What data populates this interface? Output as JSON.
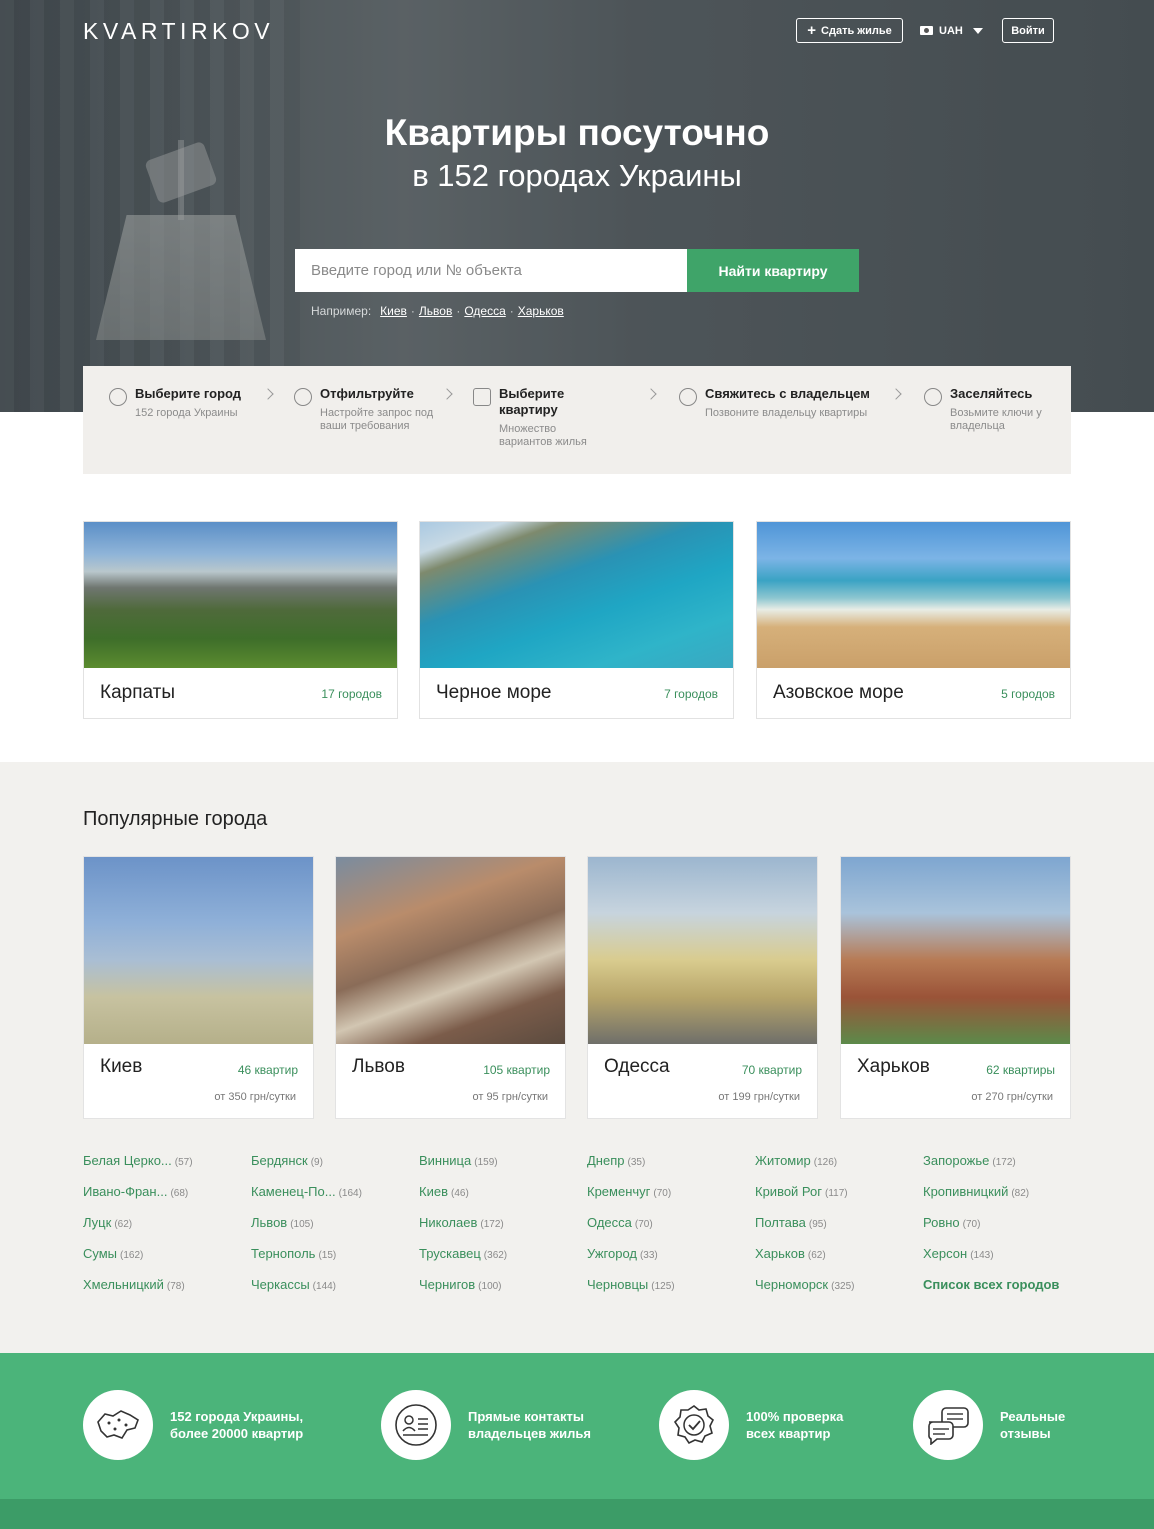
{
  "header": {
    "logo": "KVARTIRKOV",
    "rent_label": "Сдать жилье",
    "currency": "UAH",
    "login_label": "Войти"
  },
  "hero": {
    "title": "Квартиры посуточно",
    "subtitle": "в 152 городах Украины",
    "search_placeholder": "Введите город или № объекта",
    "search_button": "Найти квартиру",
    "examples_label": "Например:",
    "examples": [
      "Киев",
      "Львов",
      "Одесса",
      "Харьков"
    ]
  },
  "steps": [
    {
      "icon": "search-icon",
      "title": "Выберите город",
      "desc": "152 города Украины"
    },
    {
      "icon": "target-icon",
      "title": "Отфильтруйте",
      "desc": "Настройте запрос под ваши требования"
    },
    {
      "icon": "pin-icon",
      "title": "Выберите квартиру",
      "desc": "Множество вариантов жилья"
    },
    {
      "icon": "phone-icon",
      "title": "Свяжитесь с владельцем",
      "desc": "Позвоните владельцу квартиры"
    },
    {
      "icon": "key-icon",
      "title": "Заселяйтесь",
      "desc": "Возьмите ключи у владельца"
    }
  ],
  "regions": [
    {
      "name": "Карпаты",
      "count": "17 городов"
    },
    {
      "name": "Черное море",
      "count": "7 городов"
    },
    {
      "name": "Азовское море",
      "count": "5 городов"
    }
  ],
  "popular": {
    "title": "Популярные города",
    "cities": [
      {
        "name": "Киев",
        "count": "46 квартир",
        "price": "от 350 грн/сутки"
      },
      {
        "name": "Львов",
        "count": "105 квартир",
        "price": "от 95 грн/сутки"
      },
      {
        "name": "Одесса",
        "count": "70 квартир",
        "price": "от 199 грн/сутки"
      },
      {
        "name": "Харьков",
        "count": "62 квартиры",
        "price": "от 270 грн/сутки"
      }
    ]
  },
  "city_list": [
    [
      {
        "name": "Белая Церко...",
        "n": "(57)"
      },
      {
        "name": "Бердянск",
        "n": "(9)"
      },
      {
        "name": "Винница",
        "n": "(159)"
      },
      {
        "name": "Днепр",
        "n": "(35)"
      },
      {
        "name": "Житомир",
        "n": "(126)"
      },
      {
        "name": "Запорожье",
        "n": "(172)"
      }
    ],
    [
      {
        "name": "Ивано-Фран...",
        "n": "(68)"
      },
      {
        "name": "Каменец-По...",
        "n": "(164)"
      },
      {
        "name": "Киев",
        "n": "(46)"
      },
      {
        "name": "Кременчуг",
        "n": "(70)"
      },
      {
        "name": "Кривой Рог",
        "n": "(117)"
      },
      {
        "name": "Кропивницкий",
        "n": "(82)"
      }
    ],
    [
      {
        "name": "Луцк",
        "n": "(62)"
      },
      {
        "name": "Львов",
        "n": "(105)"
      },
      {
        "name": "Николаев",
        "n": "(172)"
      },
      {
        "name": "Одесса",
        "n": "(70)"
      },
      {
        "name": "Полтава",
        "n": "(95)"
      },
      {
        "name": "Ровно",
        "n": "(70)"
      }
    ],
    [
      {
        "name": "Сумы",
        "n": "(162)"
      },
      {
        "name": "Тернополь",
        "n": "(15)"
      },
      {
        "name": "Трускавец",
        "n": "(362)"
      },
      {
        "name": "Ужгород",
        "n": "(33)"
      },
      {
        "name": "Харьков",
        "n": "(62)"
      },
      {
        "name": "Херсон",
        "n": "(143)"
      }
    ],
    [
      {
        "name": "Хмельницкий",
        "n": "(78)"
      },
      {
        "name": "Черкассы",
        "n": "(144)"
      },
      {
        "name": "Чернигов",
        "n": "(100)"
      },
      {
        "name": "Черновцы",
        "n": "(125)"
      },
      {
        "name": "Черноморск",
        "n": "(325)"
      },
      {
        "name": "Список всех городов",
        "n": ""
      }
    ]
  ],
  "features": [
    {
      "icon": "ukraine-map-icon",
      "line1": "152 города Украины,",
      "line2": "более 20000 квартир"
    },
    {
      "icon": "contact-card-icon",
      "line1": "Прямые контакты",
      "line2": "владельцев жилья"
    },
    {
      "icon": "verified-badge-icon",
      "line1": "100% проверка",
      "line2": "всех квартир"
    },
    {
      "icon": "reviews-chat-icon",
      "line1": "Реальные",
      "line2": "отзывы"
    }
  ],
  "colors": {
    "accent": "#3fa469",
    "features_bg": "#4bb47a",
    "link": "#3a8f5c"
  }
}
